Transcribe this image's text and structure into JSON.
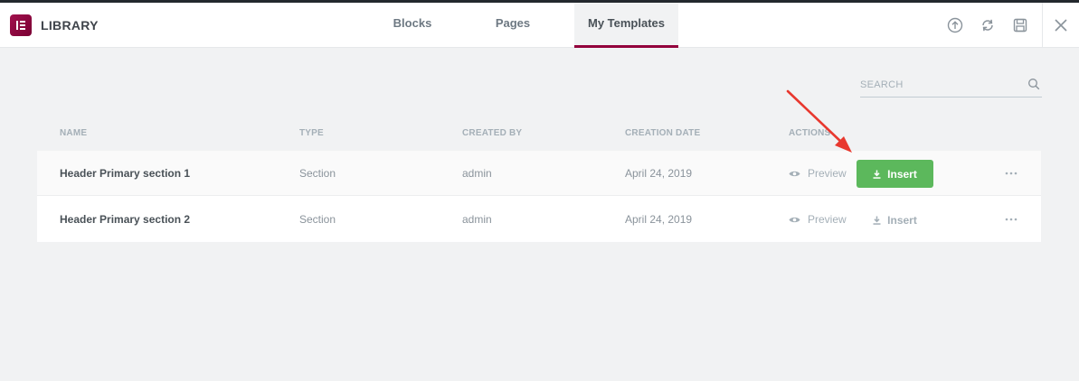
{
  "header": {
    "title": "LIBRARY",
    "tabs": [
      {
        "label": "Blocks"
      },
      {
        "label": "Pages"
      },
      {
        "label": "My Templates",
        "active": true
      }
    ],
    "actions": [
      "upload-icon",
      "sync-icon",
      "save-icon",
      "close-icon"
    ]
  },
  "search": {
    "placeholder": "SEARCH",
    "value": ""
  },
  "columns": [
    "NAME",
    "TYPE",
    "CREATED BY",
    "CREATION DATE",
    "ACTIONS"
  ],
  "rows": [
    {
      "name": "Header Primary section 1",
      "type": "Section",
      "author": "admin",
      "date": "April 24, 2019",
      "preview": "Preview",
      "insert": "Insert",
      "highlighted": true
    },
    {
      "name": "Header Primary section 2",
      "type": "Section",
      "author": "admin",
      "date": "April 24, 2019",
      "preview": "Preview",
      "insert": "Insert",
      "highlighted": false
    }
  ],
  "colors": {
    "brand": "#93003c",
    "insert_green": "#5cb85c",
    "annotation_arrow": "#e8382e"
  }
}
